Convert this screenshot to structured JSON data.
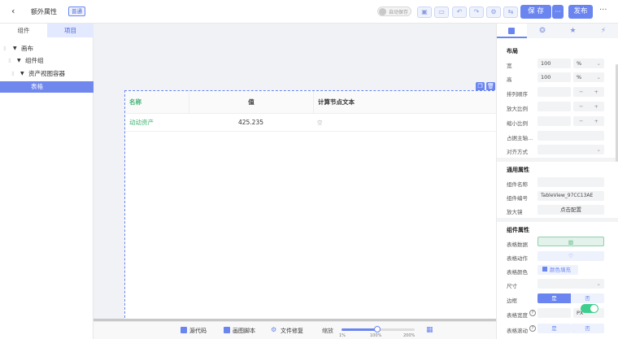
{
  "header": {
    "back_icon": "chevron-left-icon",
    "title": "额外属性",
    "badge": "普通",
    "autosave_label": "自动保存",
    "save_label": "保 存",
    "more_label": "···",
    "publish_label": "发布",
    "menu_label": "···"
  },
  "left": {
    "tabs": [
      "组件",
      "项目"
    ],
    "tree": [
      "画布",
      "组件组",
      "资产视图容器",
      "表格"
    ]
  },
  "table": {
    "columns": [
      "名称",
      "值",
      "计算节点文本"
    ],
    "rows": [
      {
        "name": "动动资产",
        "value": "425.235",
        "text": "空"
      }
    ]
  },
  "bottom": {
    "source_label": "源代码",
    "script_label": "画图脚本",
    "fix_label": "文件修复",
    "zoom_label": "缩放",
    "zoom_ticks": [
      "1%",
      "100%",
      "200%"
    ]
  },
  "right": {
    "tabs_icons": [
      "layout-icon",
      "palette-icon",
      "star-icon",
      "bolt-icon"
    ],
    "layout": {
      "title": "布局",
      "width_label": "宽",
      "width_value": "100",
      "width_unit": "%",
      "height_label": "高",
      "height_value": "100",
      "height_unit": "%",
      "order_label": "排列顺序",
      "grow_label": "放大比例",
      "shrink_label": "缩小比例",
      "basis_label": "占据主轴...",
      "align_label": "对齐方式"
    },
    "common": {
      "title": "通用属性",
      "name_label": "组件名称",
      "id_label": "组件编号",
      "id_value": "TableView_97CC13AE",
      "zoom_label": "放大镜",
      "zoom_btn": "点击配置"
    },
    "component": {
      "title": "组件属性",
      "data_label": "表格数据",
      "action_label": "表格动作",
      "color_label": "表格颜色",
      "color_btn": "颜色填充",
      "size_label": "尺寸",
      "border_label": "边框",
      "yes": "是",
      "no": "否",
      "width_label": "表格宽度",
      "width_unit": "PX",
      "scroll_label": "表格滚动"
    }
  }
}
